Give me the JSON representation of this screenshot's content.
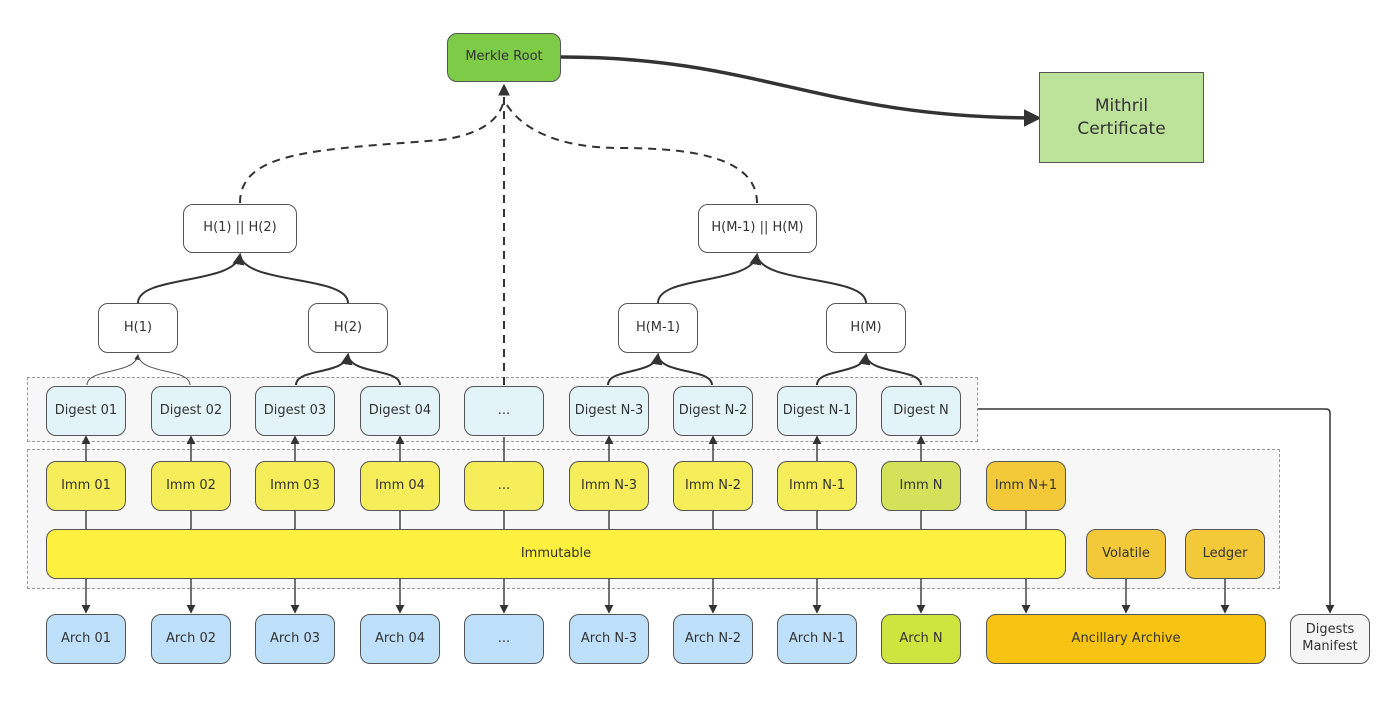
{
  "root": {
    "label": "Merkle Root"
  },
  "certificate": {
    "label_line1": "Mithril",
    "label_line2": "Certificate"
  },
  "hash_pairs": [
    {
      "label": "H(1) || H(2)"
    },
    {
      "label": "H(M-1) || H(M)"
    }
  ],
  "hashes": [
    {
      "label": "H(1)"
    },
    {
      "label": "H(2)"
    },
    {
      "label": "H(M-1)"
    },
    {
      "label": "H(M)"
    }
  ],
  "digests": [
    {
      "label": "Digest 01"
    },
    {
      "label": "Digest 02"
    },
    {
      "label": "Digest 03"
    },
    {
      "label": "Digest 04"
    },
    {
      "label": "..."
    },
    {
      "label": "Digest N-3"
    },
    {
      "label": "Digest N-2"
    },
    {
      "label": "Digest N-1"
    },
    {
      "label": "Digest N"
    }
  ],
  "imms": [
    {
      "label": "Imm 01"
    },
    {
      "label": "Imm 02"
    },
    {
      "label": "Imm 03"
    },
    {
      "label": "Imm 04"
    },
    {
      "label": "..."
    },
    {
      "label": "Imm N-3"
    },
    {
      "label": "Imm N-2"
    },
    {
      "label": "Imm N-1"
    },
    {
      "label": "Imm N"
    },
    {
      "label": "Imm N+1"
    }
  ],
  "stores": {
    "immutable": "Immutable",
    "volatile": "Volatile",
    "ledger": "Ledger"
  },
  "archives": [
    {
      "label": "Arch 01"
    },
    {
      "label": "Arch 02"
    },
    {
      "label": "Arch 03"
    },
    {
      "label": "Arch 04"
    },
    {
      "label": "..."
    },
    {
      "label": "Arch N-3"
    },
    {
      "label": "Arch N-2"
    },
    {
      "label": "Arch N-1"
    },
    {
      "label": "Arch N"
    }
  ],
  "ancillary": {
    "label": "Ancillary Archive"
  },
  "manifest": {
    "label_line1": "Digests",
    "label_line2": "Manifest"
  }
}
